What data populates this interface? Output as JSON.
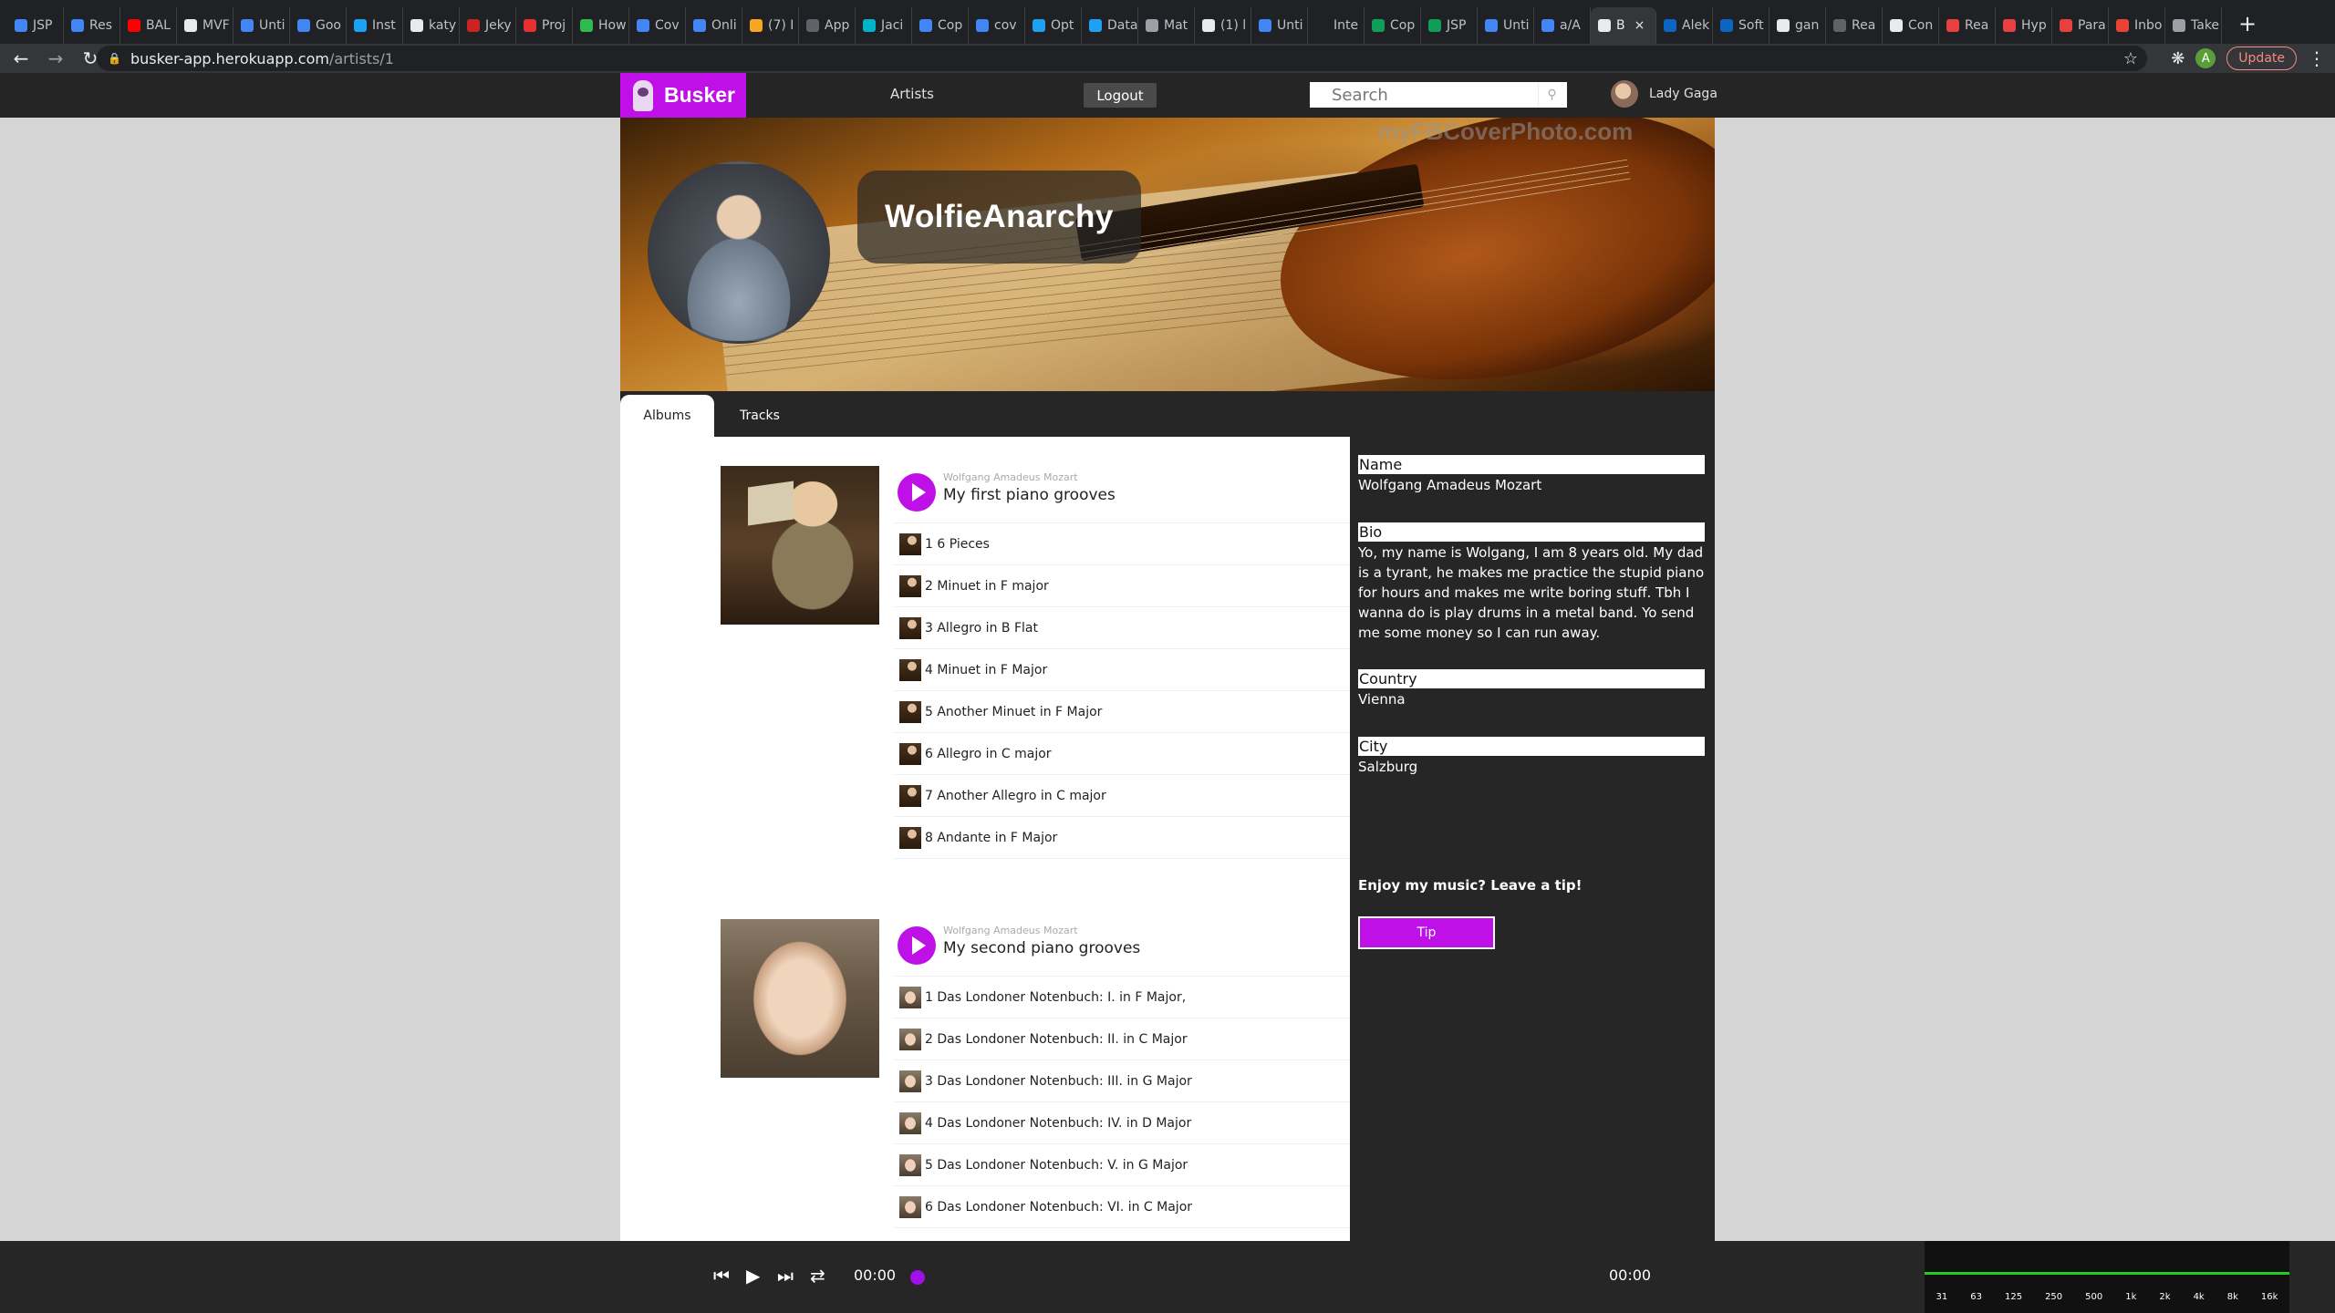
{
  "browser": {
    "tabs": [
      {
        "label": "JSP",
        "color": "#4285f4"
      },
      {
        "label": "Res",
        "color": "#4285f4"
      },
      {
        "label": "BAL",
        "color": "#ff0000"
      },
      {
        "label": "MVF",
        "color": "#e8eaed"
      },
      {
        "label": "Unti",
        "color": "#4285f4"
      },
      {
        "label": "Goo",
        "color": "#4285f4"
      },
      {
        "label": "Inst",
        "color": "#1da1f2"
      },
      {
        "label": "katy",
        "color": "#e8eaed"
      },
      {
        "label": "Jeky",
        "color": "#cc2222"
      },
      {
        "label": "Proj",
        "color": "#e83030"
      },
      {
        "label": "How",
        "color": "#2dba4e"
      },
      {
        "label": "Cov",
        "color": "#4285f4"
      },
      {
        "label": "Onli",
        "color": "#4285f4"
      },
      {
        "label": "(7) I",
        "color": "#f5a623"
      },
      {
        "label": "App",
        "color": "#5f6368"
      },
      {
        "label": "Jaci",
        "color": "#00b3c8"
      },
      {
        "label": "Cop",
        "color": "#4285f4"
      },
      {
        "label": "cov",
        "color": "#4285f4"
      },
      {
        "label": "Opt",
        "color": "#1da1f2"
      },
      {
        "label": "Data",
        "color": "#1da1f2"
      },
      {
        "label": "Mat",
        "color": "#9aa0a6"
      },
      {
        "label": "(1) l",
        "color": "#e8eaed"
      },
      {
        "label": "Unti",
        "color": "#4285f4"
      },
      {
        "label": "Inte",
        "color": "#202124"
      },
      {
        "label": "Cop",
        "color": "#0f9d58"
      },
      {
        "label": "JSP",
        "color": "#0f9d58"
      },
      {
        "label": "Unti",
        "color": "#4285f4"
      },
      {
        "label": "a/A",
        "color": "#4285f4"
      },
      {
        "label": "B",
        "color": "#e8eaed",
        "active": true
      },
      {
        "label": "Alek",
        "color": "#0a66c2"
      },
      {
        "label": "Soft",
        "color": "#0a66c2"
      },
      {
        "label": "gan",
        "color": "#e8eaed"
      },
      {
        "label": "Rea",
        "color": "#5f6368"
      },
      {
        "label": "Con",
        "color": "#e8eaed"
      },
      {
        "label": "Rea",
        "color": "#e84040"
      },
      {
        "label": "Hyp",
        "color": "#e84040"
      },
      {
        "label": "Para",
        "color": "#e84040"
      },
      {
        "label": "Inbo",
        "color": "#ea4335"
      },
      {
        "label": "Take",
        "color": "#9aa0a6"
      }
    ],
    "url_host": "busker-app.herokuapp.com",
    "url_path": "/artists/1",
    "update_label": "Update",
    "profile_letter": "A"
  },
  "nav": {
    "brand": "Busker",
    "artists_link": "Artists",
    "logout_label": "Logout",
    "search_placeholder": "Search",
    "username": "Lady Gaga"
  },
  "banner": {
    "artist_handle": "WolfieAnarchy",
    "watermark": "myFBCoverPhoto.com"
  },
  "tabs": {
    "albums": "Albums",
    "tracks": "Tracks"
  },
  "albums": [
    {
      "artist": "Wolfgang Amadeus Mozart",
      "title": "My first piano grooves",
      "tracks": [
        "1 6 Pieces",
        "2 Minuet in F major",
        "3 Allegro in B Flat",
        "4 Minuet in F Major",
        "5 Another Minuet in F Major",
        "6 Allegro in C major",
        "7 Another Allegro in C major",
        "8 Andante in F Major"
      ]
    },
    {
      "artist": "Wolfgang Amadeus Mozart",
      "title": "My second piano grooves",
      "tracks": [
        "1 Das Londoner Notenbuch: I. in F Major,",
        "2 Das Londoner Notenbuch: II. in C Major",
        "3 Das Londoner Notenbuch: III. in G Major",
        "4 Das Londoner Notenbuch: IV. in D Major",
        "5 Das Londoner Notenbuch: V. in G Major",
        "6 Das Londoner Notenbuch: VI. in C Major"
      ]
    }
  ],
  "sidebar": {
    "name_label": "Name",
    "name_value": "Wolfgang Amadeus Mozart",
    "bio_label": "Bio",
    "bio_value": "Yo, my name is Wolgang, I am 8 years old. My dad is a tyrant, he makes me practice the stupid piano for hours and makes me write boring stuff. Tbh I wanna do is play drums in a metal band. Yo send me some money so I can run away.",
    "country_label": "Country",
    "country_value": "Vienna",
    "city_label": "City",
    "city_value": "Salzburg",
    "tip_prompt": "Enjoy my music? Leave a tip!",
    "tip_button": "Tip"
  },
  "player": {
    "current_time": "00:00",
    "duration": "00:00",
    "eq_bands": [
      "31",
      "63",
      "125",
      "250",
      "500",
      "1k",
      "2k",
      "4k",
      "8k",
      "16k"
    ]
  },
  "colors": {
    "accent": "#c010e8",
    "nav_bg": "#252525",
    "sidebar_bg": "#262626"
  }
}
